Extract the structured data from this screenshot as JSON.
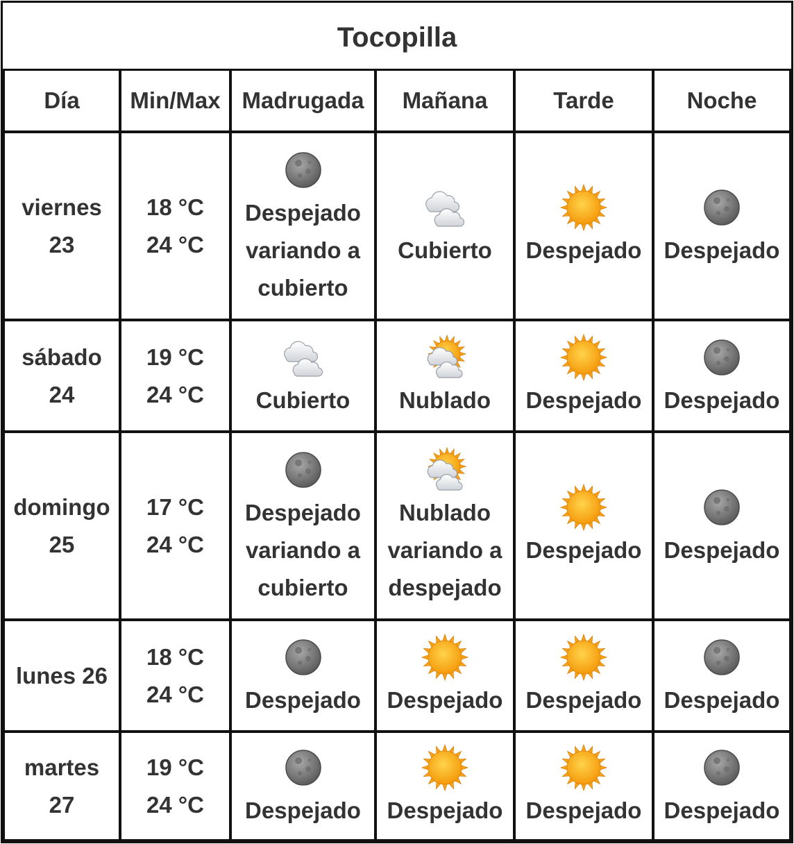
{
  "location": "Tocopilla",
  "headers": [
    "Día",
    "Min/Max",
    "Madrugada",
    "Mañana",
    "Tarde",
    "Noche"
  ],
  "days": [
    {
      "day": "viernes 23",
      "min": "18 °C",
      "max": "24 °C",
      "periods": [
        {
          "icon": "moon-icon",
          "text": "Despejado variando a cubierto"
        },
        {
          "icon": "cloud-icon",
          "text": "Cubierto"
        },
        {
          "icon": "sun-icon",
          "text": "Despejado"
        },
        {
          "icon": "moon-icon",
          "text": "Despejado"
        }
      ]
    },
    {
      "day": "sábado 24",
      "min": "19 °C",
      "max": "24 °C",
      "periods": [
        {
          "icon": "cloud-icon",
          "text": "Cubierto"
        },
        {
          "icon": "sun-cloud-icon",
          "text": "Nublado"
        },
        {
          "icon": "sun-icon",
          "text": "Despejado"
        },
        {
          "icon": "moon-icon",
          "text": "Despejado"
        }
      ]
    },
    {
      "day": "domingo 25",
      "min": "17 °C",
      "max": "24 °C",
      "periods": [
        {
          "icon": "moon-icon",
          "text": "Despejado variando a cubierto"
        },
        {
          "icon": "sun-cloud-icon",
          "text": "Nublado variando a despejado"
        },
        {
          "icon": "sun-icon",
          "text": "Despejado"
        },
        {
          "icon": "moon-icon",
          "text": "Despejado"
        }
      ]
    },
    {
      "day": "lunes 26",
      "min": "18 °C",
      "max": "24 °C",
      "periods": [
        {
          "icon": "moon-icon",
          "text": "Despejado"
        },
        {
          "icon": "sun-icon",
          "text": "Despejado"
        },
        {
          "icon": "sun-icon",
          "text": "Despejado"
        },
        {
          "icon": "moon-icon",
          "text": "Despejado"
        }
      ]
    },
    {
      "day": "martes 27",
      "min": "19 °C",
      "max": "24 °C",
      "periods": [
        {
          "icon": "moon-icon",
          "text": "Despejado"
        },
        {
          "icon": "sun-icon",
          "text": "Despejado"
        },
        {
          "icon": "sun-icon",
          "text": "Despejado"
        },
        {
          "icon": "moon-icon",
          "text": "Despejado"
        }
      ]
    }
  ]
}
